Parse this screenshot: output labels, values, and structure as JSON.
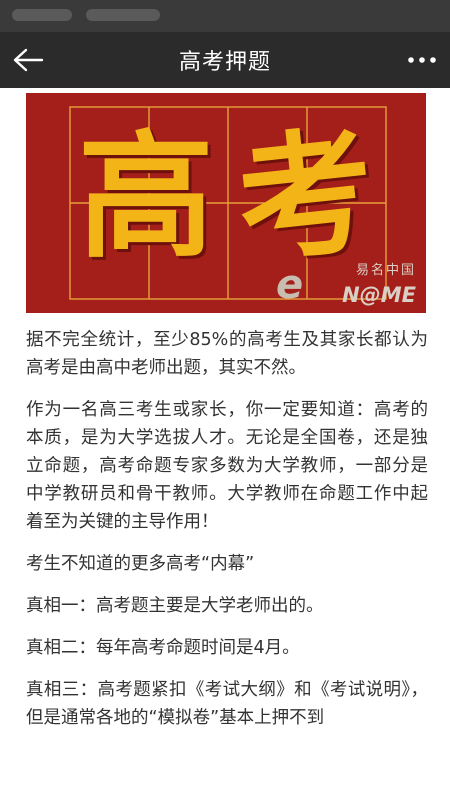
{
  "nav": {
    "title": "高考押题",
    "back_icon": "arrow-left-icon",
    "more_icon": "more-horizontal-icon"
  },
  "hero": {
    "char1": "高",
    "char2": "考",
    "watermark_cn": "易名中国",
    "watermark_en": "N@ME",
    "watermark_e": "e",
    "background_color": "#a51f1a",
    "char_color": "#f2b417"
  },
  "article": {
    "paragraphs": [
      "据不完全统计，至少85%的高考生及其家长都认为高考是由高中老师出题，其实不然。",
      "作为一名高三考生或家长，你一定要知道：高考的本质，是为大学选拔人才。无论是全国卷，还是独立命题，高考命题专家多数为大学教师，一部分是中学教研员和骨干教师。大学教师在命题工作中起着至为关键的主导作用！",
      "考生不知道的更多高考“内幕”",
      "真相一：高考题主要是大学老师出的。",
      "真相二：每年高考命题时间是4月。",
      "真相三：高考题紧扣《考试大纲》和《考试说明》，但是通常各地的“模拟卷”基本上押不到"
    ]
  }
}
